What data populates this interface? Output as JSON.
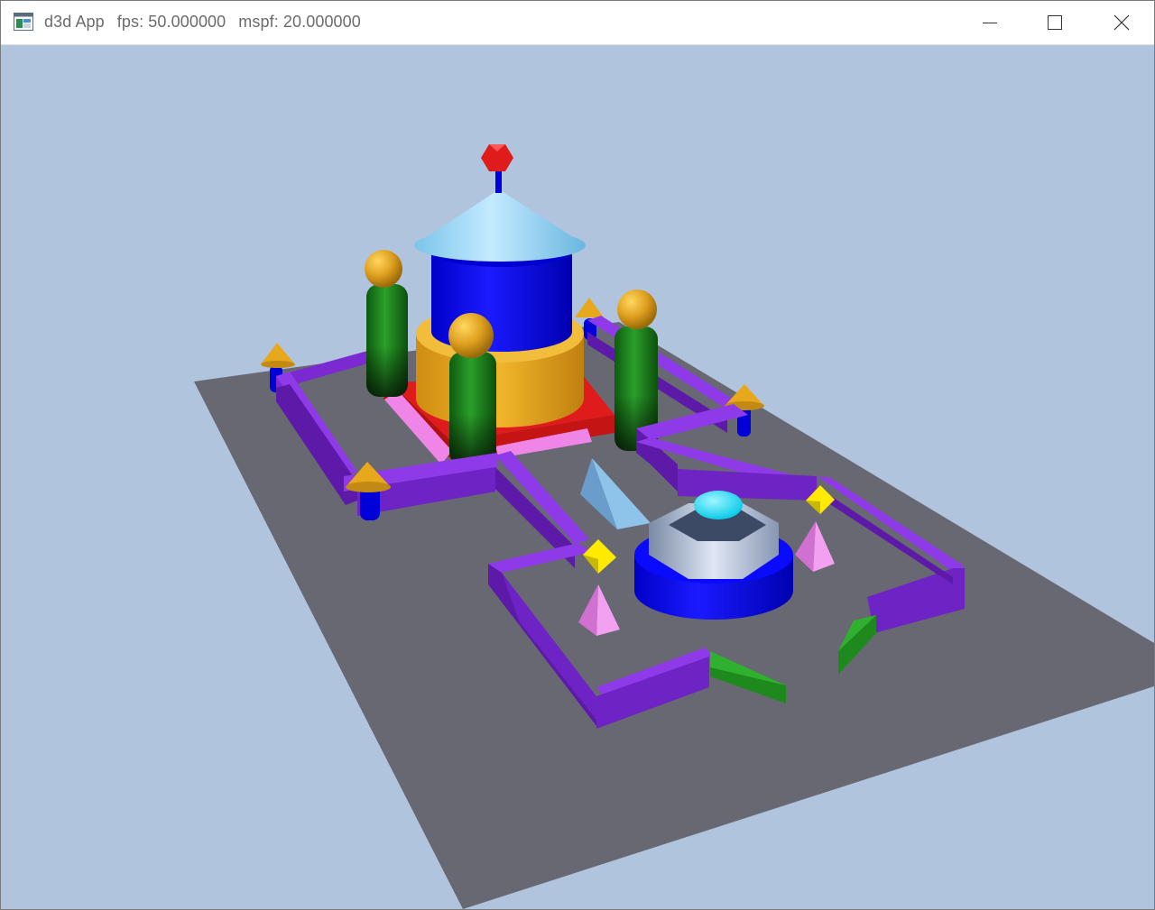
{
  "window": {
    "title": "d3d App",
    "fps_text": "fps: 50.000000",
    "mspf_text": "mspf: 20.000000",
    "icon": "app-window-icon",
    "controls": {
      "minimize_icon": "minimize-icon",
      "maximize_icon": "maximize-icon",
      "close_icon": "close-icon"
    }
  },
  "viewport": {
    "background_color": "#b0c4de",
    "ground_color": "#686872",
    "wall_color": "#6f22c0",
    "accent_colors": {
      "tower_blue": "#0000ff",
      "roof_light_blue": "#8ed2f0",
      "gold": "#e5a51e",
      "green": "#228b22",
      "red": "#e01b1b",
      "pink": "#ee82ee",
      "yellow": "#ffea00",
      "cyan": "#00e5ff"
    }
  }
}
